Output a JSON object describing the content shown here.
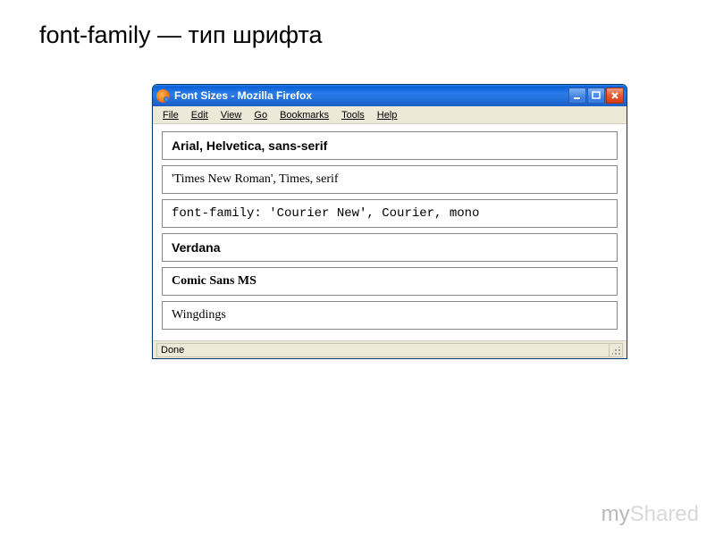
{
  "slide_title": "font-family — тип шрифта",
  "window": {
    "title": "Font Sizes - Mozilla Firefox",
    "menu": [
      "File",
      "Edit",
      "View",
      "Go",
      "Bookmarks",
      "Tools",
      "Help"
    ],
    "status": "Done"
  },
  "font_samples": [
    {
      "text": "Arial, Helvetica, sans-serif",
      "class": "f-arial"
    },
    {
      "text": "'Times New Roman', Times, serif",
      "class": "f-times"
    },
    {
      "text": "font-family: 'Courier New', Courier, mono",
      "class": "f-courier"
    },
    {
      "text": "Verdana",
      "class": "f-verdana"
    },
    {
      "text": "Comic Sans MS",
      "class": "f-comic"
    },
    {
      "text": "Wingdings",
      "class": "f-wingdings"
    }
  ],
  "watermark": {
    "part1": "my",
    "part2": "Shared"
  }
}
